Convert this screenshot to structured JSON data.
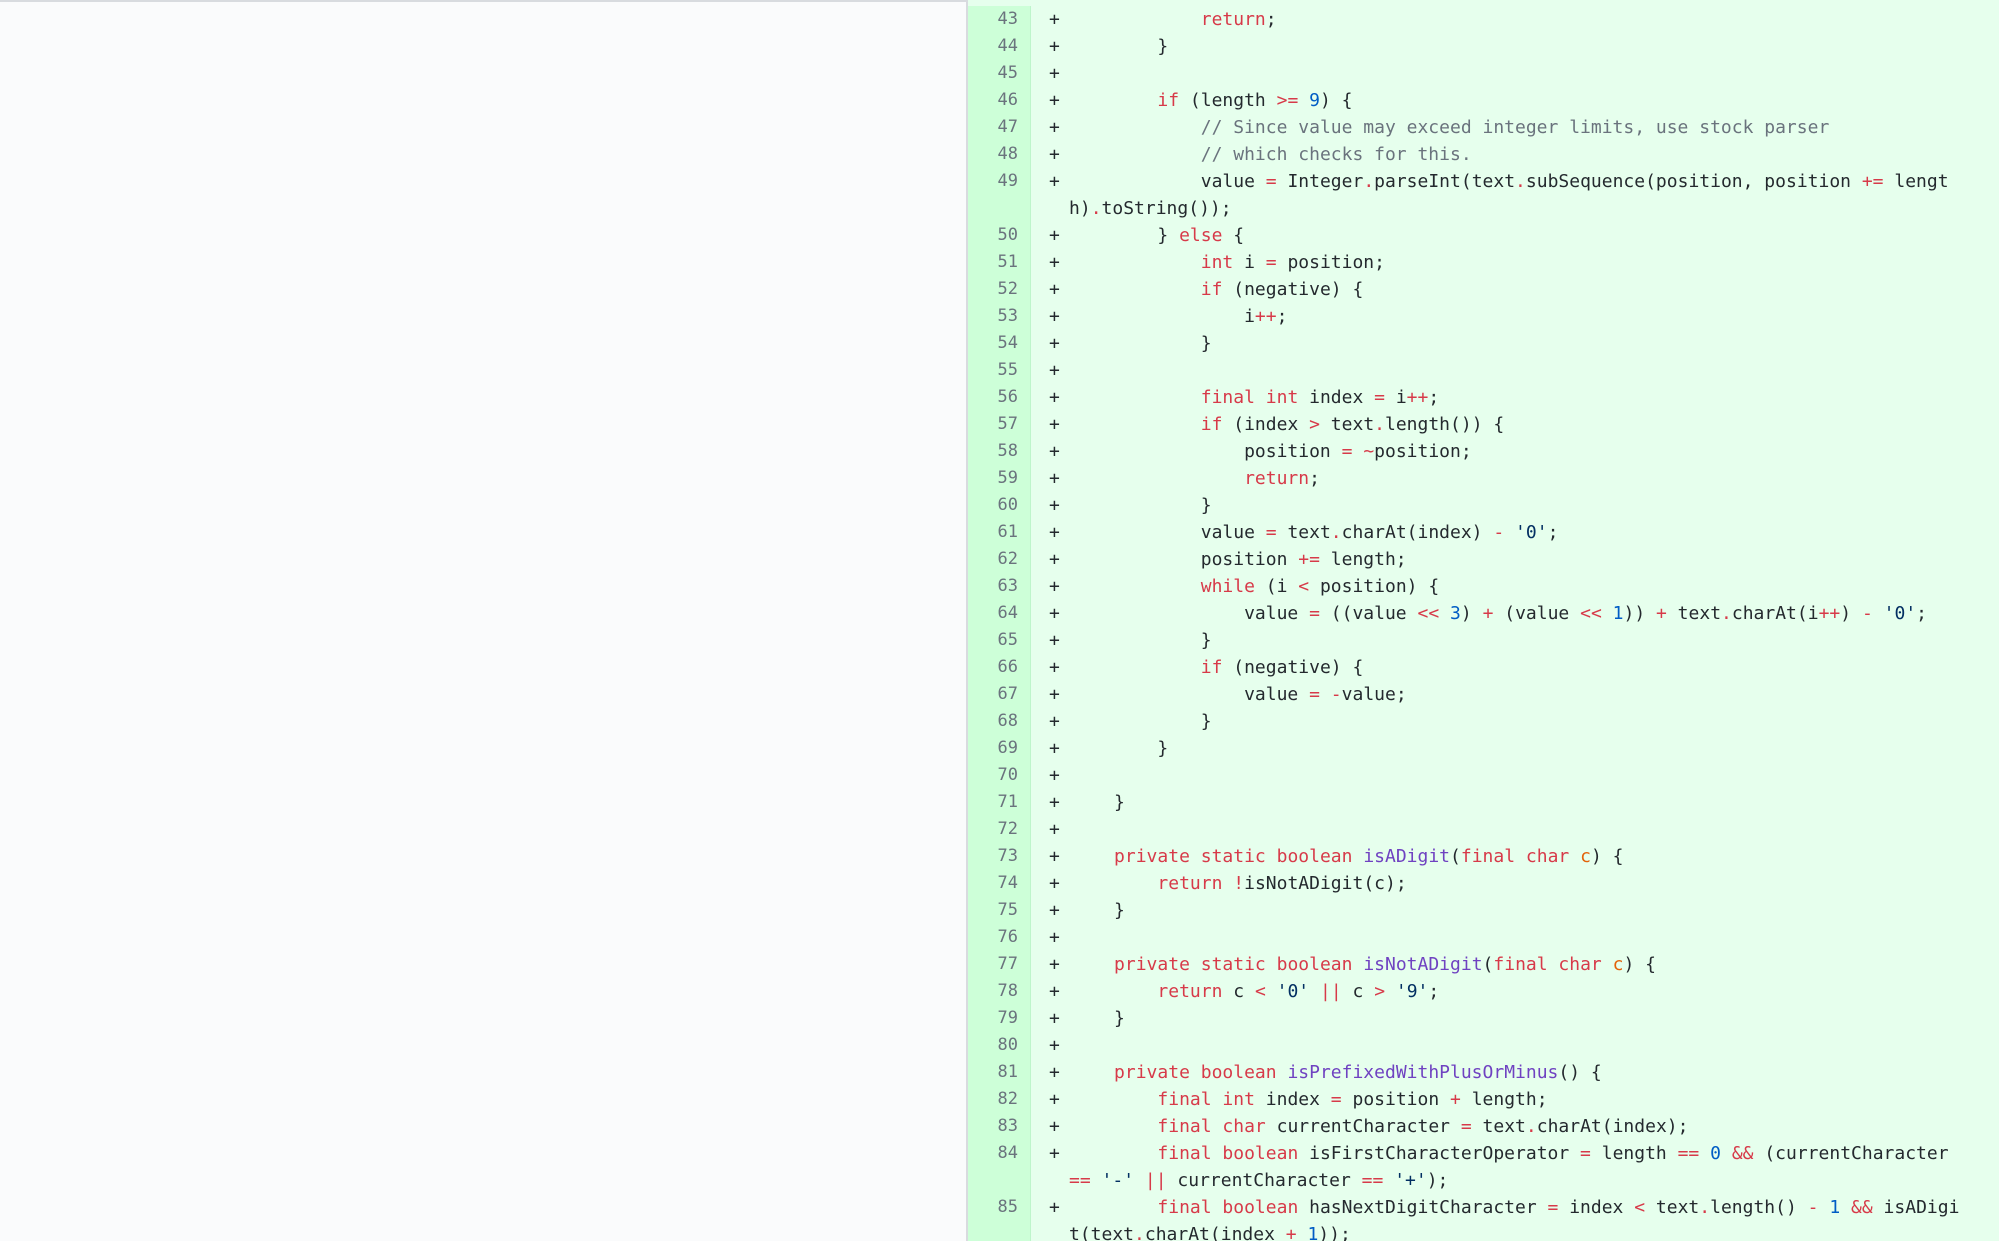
{
  "colors": {
    "added_bg": "#e6ffed",
    "gutter_bg": "#cdffd8",
    "left_pane_bg": "#fafbfc",
    "keyword": "#d73a49",
    "number": "#005cc5",
    "string": "#032f62",
    "comment": "#6a737d",
    "function": "#6f42c1",
    "param": "#e36209"
  },
  "diff": {
    "marker": "+",
    "lines": [
      {
        "n": "43",
        "t": [
          [
            "            ",
            ""
          ],
          [
            "return",
            "k"
          ],
          [
            ";",
            ""
          ]
        ]
      },
      {
        "n": "44",
        "t": [
          [
            "        }",
            ""
          ]
        ]
      },
      {
        "n": "45",
        "t": []
      },
      {
        "n": "46",
        "t": [
          [
            "        ",
            ""
          ],
          [
            "if",
            "k"
          ],
          [
            " (length ",
            ""
          ],
          [
            ">=",
            "k"
          ],
          [
            " ",
            ""
          ],
          [
            "9",
            "n"
          ],
          [
            ") {",
            ""
          ]
        ]
      },
      {
        "n": "47",
        "t": [
          [
            "            ",
            ""
          ],
          [
            "// Since value may exceed integer limits, use stock parser",
            "c"
          ]
        ]
      },
      {
        "n": "48",
        "t": [
          [
            "            ",
            ""
          ],
          [
            "// which checks for this.",
            "c"
          ]
        ]
      },
      {
        "n": "49",
        "t": [
          [
            "            value ",
            ""
          ],
          [
            "=",
            "k"
          ],
          [
            " Integer",
            ""
          ],
          [
            ".",
            "k"
          ],
          [
            "parseInt(text",
            ""
          ],
          [
            ".",
            "k"
          ],
          [
            "subSequence(position, position ",
            ""
          ],
          [
            "+=",
            "k"
          ],
          [
            " length)",
            ""
          ],
          [
            ".",
            "k"
          ],
          [
            "toString());",
            ""
          ]
        ]
      },
      {
        "n": "50",
        "t": [
          [
            "        } ",
            ""
          ],
          [
            "else",
            "k"
          ],
          [
            " {",
            ""
          ]
        ]
      },
      {
        "n": "51",
        "t": [
          [
            "            ",
            ""
          ],
          [
            "int",
            "k"
          ],
          [
            " i ",
            ""
          ],
          [
            "=",
            "k"
          ],
          [
            " position;",
            ""
          ]
        ]
      },
      {
        "n": "52",
        "t": [
          [
            "            ",
            ""
          ],
          [
            "if",
            "k"
          ],
          [
            " (negative) {",
            ""
          ]
        ]
      },
      {
        "n": "53",
        "t": [
          [
            "                i",
            ""
          ],
          [
            "++",
            "k"
          ],
          [
            ";",
            ""
          ]
        ]
      },
      {
        "n": "54",
        "t": [
          [
            "            }",
            ""
          ]
        ]
      },
      {
        "n": "55",
        "t": []
      },
      {
        "n": "56",
        "t": [
          [
            "            ",
            ""
          ],
          [
            "final",
            "k"
          ],
          [
            " ",
            ""
          ],
          [
            "int",
            "k"
          ],
          [
            " index ",
            ""
          ],
          [
            "=",
            "k"
          ],
          [
            " i",
            ""
          ],
          [
            "++",
            "k"
          ],
          [
            ";",
            ""
          ]
        ]
      },
      {
        "n": "57",
        "t": [
          [
            "            ",
            ""
          ],
          [
            "if",
            "k"
          ],
          [
            " (index ",
            ""
          ],
          [
            ">",
            "k"
          ],
          [
            " text",
            ""
          ],
          [
            ".",
            "k"
          ],
          [
            "length()) {",
            ""
          ]
        ]
      },
      {
        "n": "58",
        "t": [
          [
            "                position ",
            ""
          ],
          [
            "=",
            "k"
          ],
          [
            " ",
            ""
          ],
          [
            "~",
            "k"
          ],
          [
            "position;",
            ""
          ]
        ]
      },
      {
        "n": "59",
        "t": [
          [
            "                ",
            ""
          ],
          [
            "return",
            "k"
          ],
          [
            ";",
            ""
          ]
        ]
      },
      {
        "n": "60",
        "t": [
          [
            "            }",
            ""
          ]
        ]
      },
      {
        "n": "61",
        "t": [
          [
            "            value ",
            ""
          ],
          [
            "=",
            "k"
          ],
          [
            " text",
            ""
          ],
          [
            ".",
            "k"
          ],
          [
            "charAt(index) ",
            ""
          ],
          [
            "-",
            "k"
          ],
          [
            " ",
            ""
          ],
          [
            "'0'",
            "s"
          ],
          [
            ";",
            ""
          ]
        ]
      },
      {
        "n": "62",
        "t": [
          [
            "            position ",
            ""
          ],
          [
            "+=",
            "k"
          ],
          [
            " length;",
            ""
          ]
        ]
      },
      {
        "n": "63",
        "t": [
          [
            "            ",
            ""
          ],
          [
            "while",
            "k"
          ],
          [
            " (i ",
            ""
          ],
          [
            "<",
            "k"
          ],
          [
            " position) {",
            ""
          ]
        ]
      },
      {
        "n": "64",
        "t": [
          [
            "                value ",
            ""
          ],
          [
            "=",
            "k"
          ],
          [
            " ((value ",
            ""
          ],
          [
            "<<",
            "k"
          ],
          [
            " ",
            ""
          ],
          [
            "3",
            "n"
          ],
          [
            ") ",
            ""
          ],
          [
            "+",
            "k"
          ],
          [
            " (value ",
            ""
          ],
          [
            "<<",
            "k"
          ],
          [
            " ",
            ""
          ],
          [
            "1",
            "n"
          ],
          [
            ")) ",
            ""
          ],
          [
            "+",
            "k"
          ],
          [
            " text",
            ""
          ],
          [
            ".",
            "k"
          ],
          [
            "charAt(i",
            ""
          ],
          [
            "++",
            "k"
          ],
          [
            ") ",
            ""
          ],
          [
            "-",
            "k"
          ],
          [
            " ",
            ""
          ],
          [
            "'0'",
            "s"
          ],
          [
            ";",
            ""
          ]
        ]
      },
      {
        "n": "65",
        "t": [
          [
            "            }",
            ""
          ]
        ]
      },
      {
        "n": "66",
        "t": [
          [
            "            ",
            ""
          ],
          [
            "if",
            "k"
          ],
          [
            " (negative) {",
            ""
          ]
        ]
      },
      {
        "n": "67",
        "t": [
          [
            "                value ",
            ""
          ],
          [
            "=",
            "k"
          ],
          [
            " ",
            ""
          ],
          [
            "-",
            "k"
          ],
          [
            "value;",
            ""
          ]
        ]
      },
      {
        "n": "68",
        "t": [
          [
            "            }",
            ""
          ]
        ]
      },
      {
        "n": "69",
        "t": [
          [
            "        }",
            ""
          ]
        ]
      },
      {
        "n": "70",
        "t": []
      },
      {
        "n": "71",
        "t": [
          [
            "    }",
            ""
          ]
        ]
      },
      {
        "n": "72",
        "t": []
      },
      {
        "n": "73",
        "t": [
          [
            "    ",
            ""
          ],
          [
            "private",
            "k"
          ],
          [
            " ",
            ""
          ],
          [
            "static",
            "k"
          ],
          [
            " ",
            ""
          ],
          [
            "boolean",
            "k"
          ],
          [
            " ",
            ""
          ],
          [
            "isADigit",
            "f"
          ],
          [
            "(",
            ""
          ],
          [
            "final",
            "k"
          ],
          [
            " ",
            ""
          ],
          [
            "char",
            "k"
          ],
          [
            " ",
            ""
          ],
          [
            "c",
            "p"
          ],
          [
            ") {",
            ""
          ]
        ]
      },
      {
        "n": "74",
        "t": [
          [
            "        ",
            ""
          ],
          [
            "return",
            "k"
          ],
          [
            " ",
            ""
          ],
          [
            "!",
            "k"
          ],
          [
            "isNotADigit(c);",
            ""
          ]
        ]
      },
      {
        "n": "75",
        "t": [
          [
            "    }",
            ""
          ]
        ]
      },
      {
        "n": "76",
        "t": []
      },
      {
        "n": "77",
        "t": [
          [
            "    ",
            ""
          ],
          [
            "private",
            "k"
          ],
          [
            " ",
            ""
          ],
          [
            "static",
            "k"
          ],
          [
            " ",
            ""
          ],
          [
            "boolean",
            "k"
          ],
          [
            " ",
            ""
          ],
          [
            "isNotADigit",
            "f"
          ],
          [
            "(",
            ""
          ],
          [
            "final",
            "k"
          ],
          [
            " ",
            ""
          ],
          [
            "char",
            "k"
          ],
          [
            " ",
            ""
          ],
          [
            "c",
            "p"
          ],
          [
            ") {",
            ""
          ]
        ]
      },
      {
        "n": "78",
        "t": [
          [
            "        ",
            ""
          ],
          [
            "return",
            "k"
          ],
          [
            " c ",
            ""
          ],
          [
            "<",
            "k"
          ],
          [
            " ",
            ""
          ],
          [
            "'0'",
            "s"
          ],
          [
            " ",
            ""
          ],
          [
            "||",
            "k"
          ],
          [
            " c ",
            ""
          ],
          [
            ">",
            "k"
          ],
          [
            " ",
            ""
          ],
          [
            "'9'",
            "s"
          ],
          [
            ";",
            ""
          ]
        ]
      },
      {
        "n": "79",
        "t": [
          [
            "    }",
            ""
          ]
        ]
      },
      {
        "n": "80",
        "t": []
      },
      {
        "n": "81",
        "t": [
          [
            "    ",
            ""
          ],
          [
            "private",
            "k"
          ],
          [
            " ",
            ""
          ],
          [
            "boolean",
            "k"
          ],
          [
            " ",
            ""
          ],
          [
            "isPrefixedWithPlusOrMinus",
            "f"
          ],
          [
            "() {",
            ""
          ]
        ]
      },
      {
        "n": "82",
        "t": [
          [
            "        ",
            ""
          ],
          [
            "final",
            "k"
          ],
          [
            " ",
            ""
          ],
          [
            "int",
            "k"
          ],
          [
            " index ",
            ""
          ],
          [
            "=",
            "k"
          ],
          [
            " position ",
            ""
          ],
          [
            "+",
            "k"
          ],
          [
            " length;",
            ""
          ]
        ]
      },
      {
        "n": "83",
        "t": [
          [
            "        ",
            ""
          ],
          [
            "final",
            "k"
          ],
          [
            " ",
            ""
          ],
          [
            "char",
            "k"
          ],
          [
            " currentCharacter ",
            ""
          ],
          [
            "=",
            "k"
          ],
          [
            " text",
            ""
          ],
          [
            ".",
            "k"
          ],
          [
            "charAt(index);",
            ""
          ]
        ]
      },
      {
        "n": "84",
        "t": [
          [
            "        ",
            ""
          ],
          [
            "final",
            "k"
          ],
          [
            " ",
            ""
          ],
          [
            "boolean",
            "k"
          ],
          [
            " isFirstCharacterOperator ",
            ""
          ],
          [
            "=",
            "k"
          ],
          [
            " length ",
            ""
          ],
          [
            "==",
            "k"
          ],
          [
            " ",
            ""
          ],
          [
            "0",
            "n"
          ],
          [
            " ",
            ""
          ],
          [
            "&&",
            "k"
          ],
          [
            " (currentCharacter ",
            ""
          ],
          [
            "==",
            "k"
          ],
          [
            " ",
            ""
          ],
          [
            "'-'",
            "s"
          ],
          [
            " ",
            ""
          ],
          [
            "||",
            "k"
          ],
          [
            " currentCharacter ",
            ""
          ],
          [
            "==",
            "k"
          ],
          [
            " ",
            ""
          ],
          [
            "'+'",
            "s"
          ],
          [
            ");",
            ""
          ]
        ]
      },
      {
        "n": "85",
        "t": [
          [
            "        ",
            ""
          ],
          [
            "final",
            "k"
          ],
          [
            " ",
            ""
          ],
          [
            "boolean",
            "k"
          ],
          [
            " hasNextDigitCharacter ",
            ""
          ],
          [
            "=",
            "k"
          ],
          [
            " index ",
            ""
          ],
          [
            "<",
            "k"
          ],
          [
            " text",
            ""
          ],
          [
            ".",
            "k"
          ],
          [
            "length() ",
            ""
          ],
          [
            "-",
            "k"
          ],
          [
            " ",
            ""
          ],
          [
            "1",
            "n"
          ],
          [
            " ",
            ""
          ],
          [
            "&&",
            "k"
          ],
          [
            " isADigit(text",
            ""
          ],
          [
            ".",
            "k"
          ],
          [
            "charAt(index ",
            ""
          ],
          [
            "+",
            "k"
          ],
          [
            " ",
            ""
          ],
          [
            "1",
            "n"
          ],
          [
            "));",
            ""
          ]
        ]
      }
    ]
  }
}
